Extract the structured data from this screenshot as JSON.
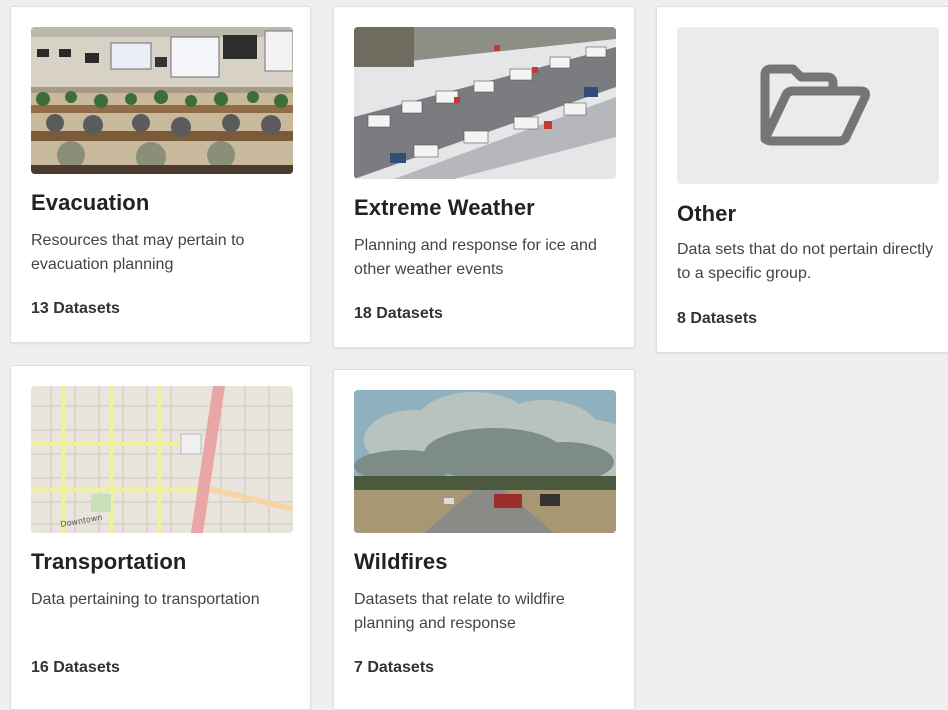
{
  "categories": [
    {
      "title": "Evacuation",
      "description": "Resources that may pertain to evacuation planning",
      "count": "13 Datasets",
      "image": "operations-center-photo"
    },
    {
      "title": "Extreme Weather",
      "description": "Planning and response for ice and other weather events",
      "count": "18 Datasets",
      "image": "icy-highway-traffic-photo"
    },
    {
      "title": "Other",
      "description": "Data sets that do not pertain directly to a specific group.",
      "count": "8 Datasets",
      "image": "folder-icon"
    },
    {
      "title": "Transportation",
      "description": "Data pertaining to transportation",
      "count": "16 Datasets",
      "image": "street-map-image"
    },
    {
      "title": "Wildfires",
      "description": "Datasets that relate to wildfire planning and response",
      "count": "7 Datasets",
      "image": "wildfire-smoke-highway-photo"
    }
  ],
  "colors": {
    "page_background": "#efefef",
    "card_background": "#ffffff",
    "folder_icon": "#757575",
    "placeholder_background": "#ebebeb"
  }
}
